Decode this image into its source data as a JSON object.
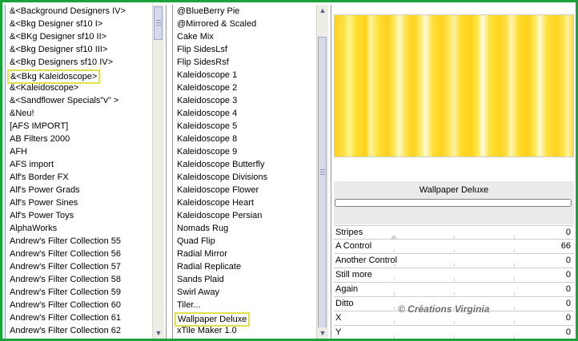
{
  "left_list": {
    "items": [
      "&<Background Designers IV>",
      "&<Bkg Designer sf10 I>",
      "&<BKg Designer sf10 II>",
      "&<Bkg Designer sf10 III>",
      "&<Bkg Designers sf10 IV>",
      "&<Bkg Kaleidoscope>",
      "&<Kaleidoscope>",
      "&<Sandflower Specials\"v\" >",
      "&Neu!",
      "[AFS IMPORT]",
      "AB Filters 2000",
      "AFH",
      "AFS import",
      "Alf's Border FX",
      "Alf's Power Grads",
      "Alf's Power Sines",
      "Alf's Power Toys",
      "AlphaWorks",
      "Andrew's Filter Collection 55",
      "Andrew's Filter Collection 56",
      "Andrew's Filter Collection 57",
      "Andrew's Filter Collection 58",
      "Andrew's Filter Collection 59",
      "Andrew's Filter Collection 60",
      "Andrew's Filter Collection 61",
      "Andrew's Filter Collection 62"
    ],
    "selected_index": 5
  },
  "right_list": {
    "items": [
      "@BlueBerry Pie",
      "@Mirrored & Scaled",
      "Cake Mix",
      "Flip SidesLsf",
      "Flip SidesRsf",
      "Kaleidoscope 1",
      "Kaleidoscope 2",
      "Kaleidoscope 3",
      "Kaleidoscope 4",
      "Kaleidoscope 5",
      "Kaleidoscope 8",
      "Kaleidoscope 9",
      "Kaleidoscope Butterfly",
      "Kaleidoscope Divisions",
      "Kaleidoscope Flower",
      "Kaleidoscope Heart",
      "Kaleidoscope Persian",
      "Nomads Rug",
      "Quad Flip",
      "Radial Mirror",
      "Radial Replicate",
      "Sands Plaid",
      "Swirl Away",
      "Tiler...",
      "Wallpaper Deluxe",
      "xTile Maker 1.0"
    ],
    "selected_index": 24
  },
  "filter_title": "Wallpaper Deluxe",
  "controls": [
    {
      "label": "Stripes",
      "value": "0"
    },
    {
      "label": "A Control",
      "value": "66"
    },
    {
      "label": "Another Control",
      "value": "0"
    },
    {
      "label": "Still more",
      "value": "0"
    },
    {
      "label": "Again",
      "value": "0"
    },
    {
      "label": "Ditto",
      "value": "0"
    },
    {
      "label": "X",
      "value": "0"
    },
    {
      "label": "Y",
      "value": "0"
    }
  ],
  "watermark": "© Créations Virginia",
  "colors": {
    "frame": "#1aa33a",
    "selection_border": "#e4e04a",
    "preview_base": "#ffd21f"
  },
  "icons": {
    "scroll_up": "chevron-up-icon",
    "scroll_down": "chevron-down-icon"
  }
}
